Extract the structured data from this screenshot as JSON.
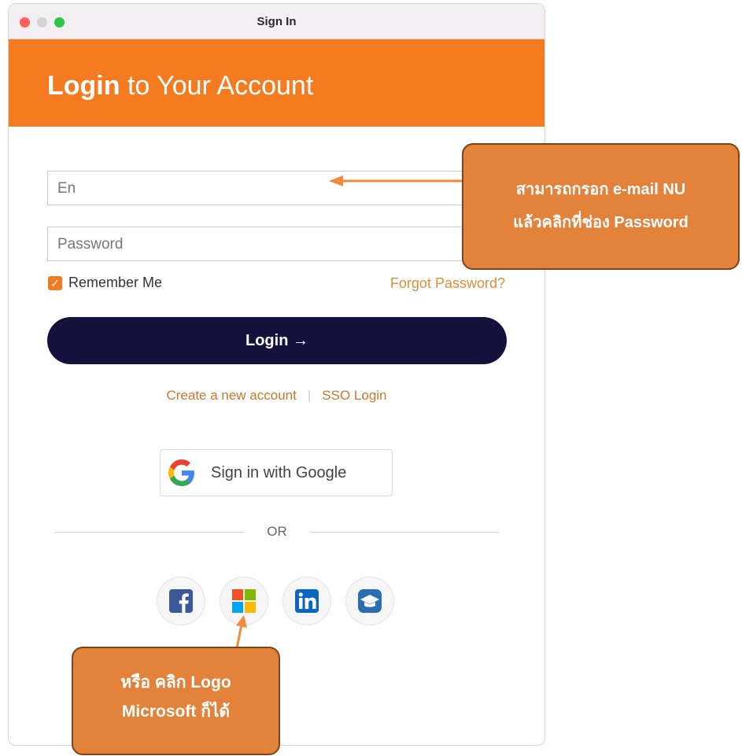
{
  "window": {
    "title": "Sign In"
  },
  "header": {
    "title_bold": "Login",
    "title_rest": " to Your Account"
  },
  "form": {
    "email_placeholder": "En",
    "password_placeholder": "Password",
    "remember_label": "Remember Me",
    "remember_checked": true,
    "forgot_label": "Forgot Password?",
    "login_label": "Login  →"
  },
  "links": {
    "create_account": "Create a new account",
    "separator": "|",
    "sso_login": "SSO Login"
  },
  "google": {
    "label": "Sign in with Google"
  },
  "divider": {
    "label": "OR"
  },
  "social": [
    "facebook-icon",
    "microsoft-icon",
    "linkedin-icon",
    "education-icon"
  ],
  "colors": {
    "accent": "#f57b20",
    "button": "#14123d",
    "link": "#c8782f",
    "callout": "#e2823b"
  },
  "callouts": {
    "email_hint_line1": "สามารถกรอก e-mail NU",
    "email_hint_line2": "แล้วคลิกที่ช่อง Password",
    "microsoft_hint_line1": "หรือ คลิก Logo",
    "microsoft_hint_line2": "Microsoft ก็ได้"
  }
}
